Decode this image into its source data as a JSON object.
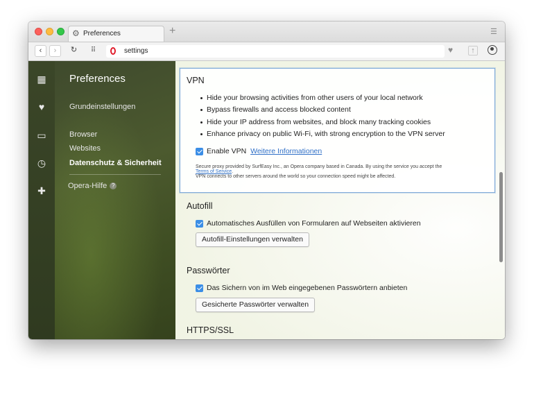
{
  "browser": {
    "tab_title": "Preferences",
    "url": "settings",
    "new_tab_symbol": "+",
    "icons": [
      "gear-icon",
      "back-icon",
      "forward-icon",
      "reload-icon",
      "speed-dial-icon",
      "opera-logo-icon",
      "heart-icon",
      "share-icon",
      "account-icon",
      "tab-menu-icon"
    ]
  },
  "sidebar": {
    "icons": [
      "speed-dial-icon",
      "heart-icon",
      "devices-icon",
      "history-icon",
      "extensions-icon"
    ]
  },
  "preferences": {
    "title": "Preferences",
    "items": [
      {
        "label": "Grundeinstellungen"
      },
      {
        "label": "Browser"
      },
      {
        "label": "Websites"
      },
      {
        "label": "Datenschutz & Sicherheit",
        "active": true
      }
    ],
    "help_label": "Opera-Hilfe",
    "help_symbol": "?"
  },
  "vpn": {
    "title": "VPN",
    "bullets": [
      "Hide your browsing activities from other users of your local network",
      "Bypass firewalls and access blocked content",
      "Hide your IP address from websites, and block many tracking cookies",
      "Enhance privacy on public Wi-Fi, with strong encryption to the VPN server"
    ],
    "enable_label": "Enable VPN",
    "enable_checked": true,
    "more_info_link": "Weitere Informationen",
    "fine_print_1": "Secure proxy provided by SurfEasy Inc., an Opera company based in Canada. By using the service you accept the",
    "terms_link": "Terms of Service",
    "fine_print_period": ".",
    "fine_print_2": "VPN connects to other servers around the world so your connection speed might be affected."
  },
  "autofill": {
    "title": "Autofill",
    "checkbox_label": "Automatisches Ausfüllen von Formularen auf Webseiten aktivieren",
    "checked": true,
    "button_label": "Autofill-Einstellungen verwalten"
  },
  "passwords": {
    "title": "Passwörter",
    "checkbox_label": "Das Sichern von im Web eingegebenen Passwörtern anbieten",
    "checked": true,
    "button_label": "Gesicherte Passwörter verwalten"
  },
  "https": {
    "title": "HTTPS/SSL"
  },
  "colors": {
    "accent": "#3b8ee6",
    "link": "#2f6fc7",
    "sidebar_bg": "#3b4628",
    "vpn_border": "#7ea9d8"
  }
}
